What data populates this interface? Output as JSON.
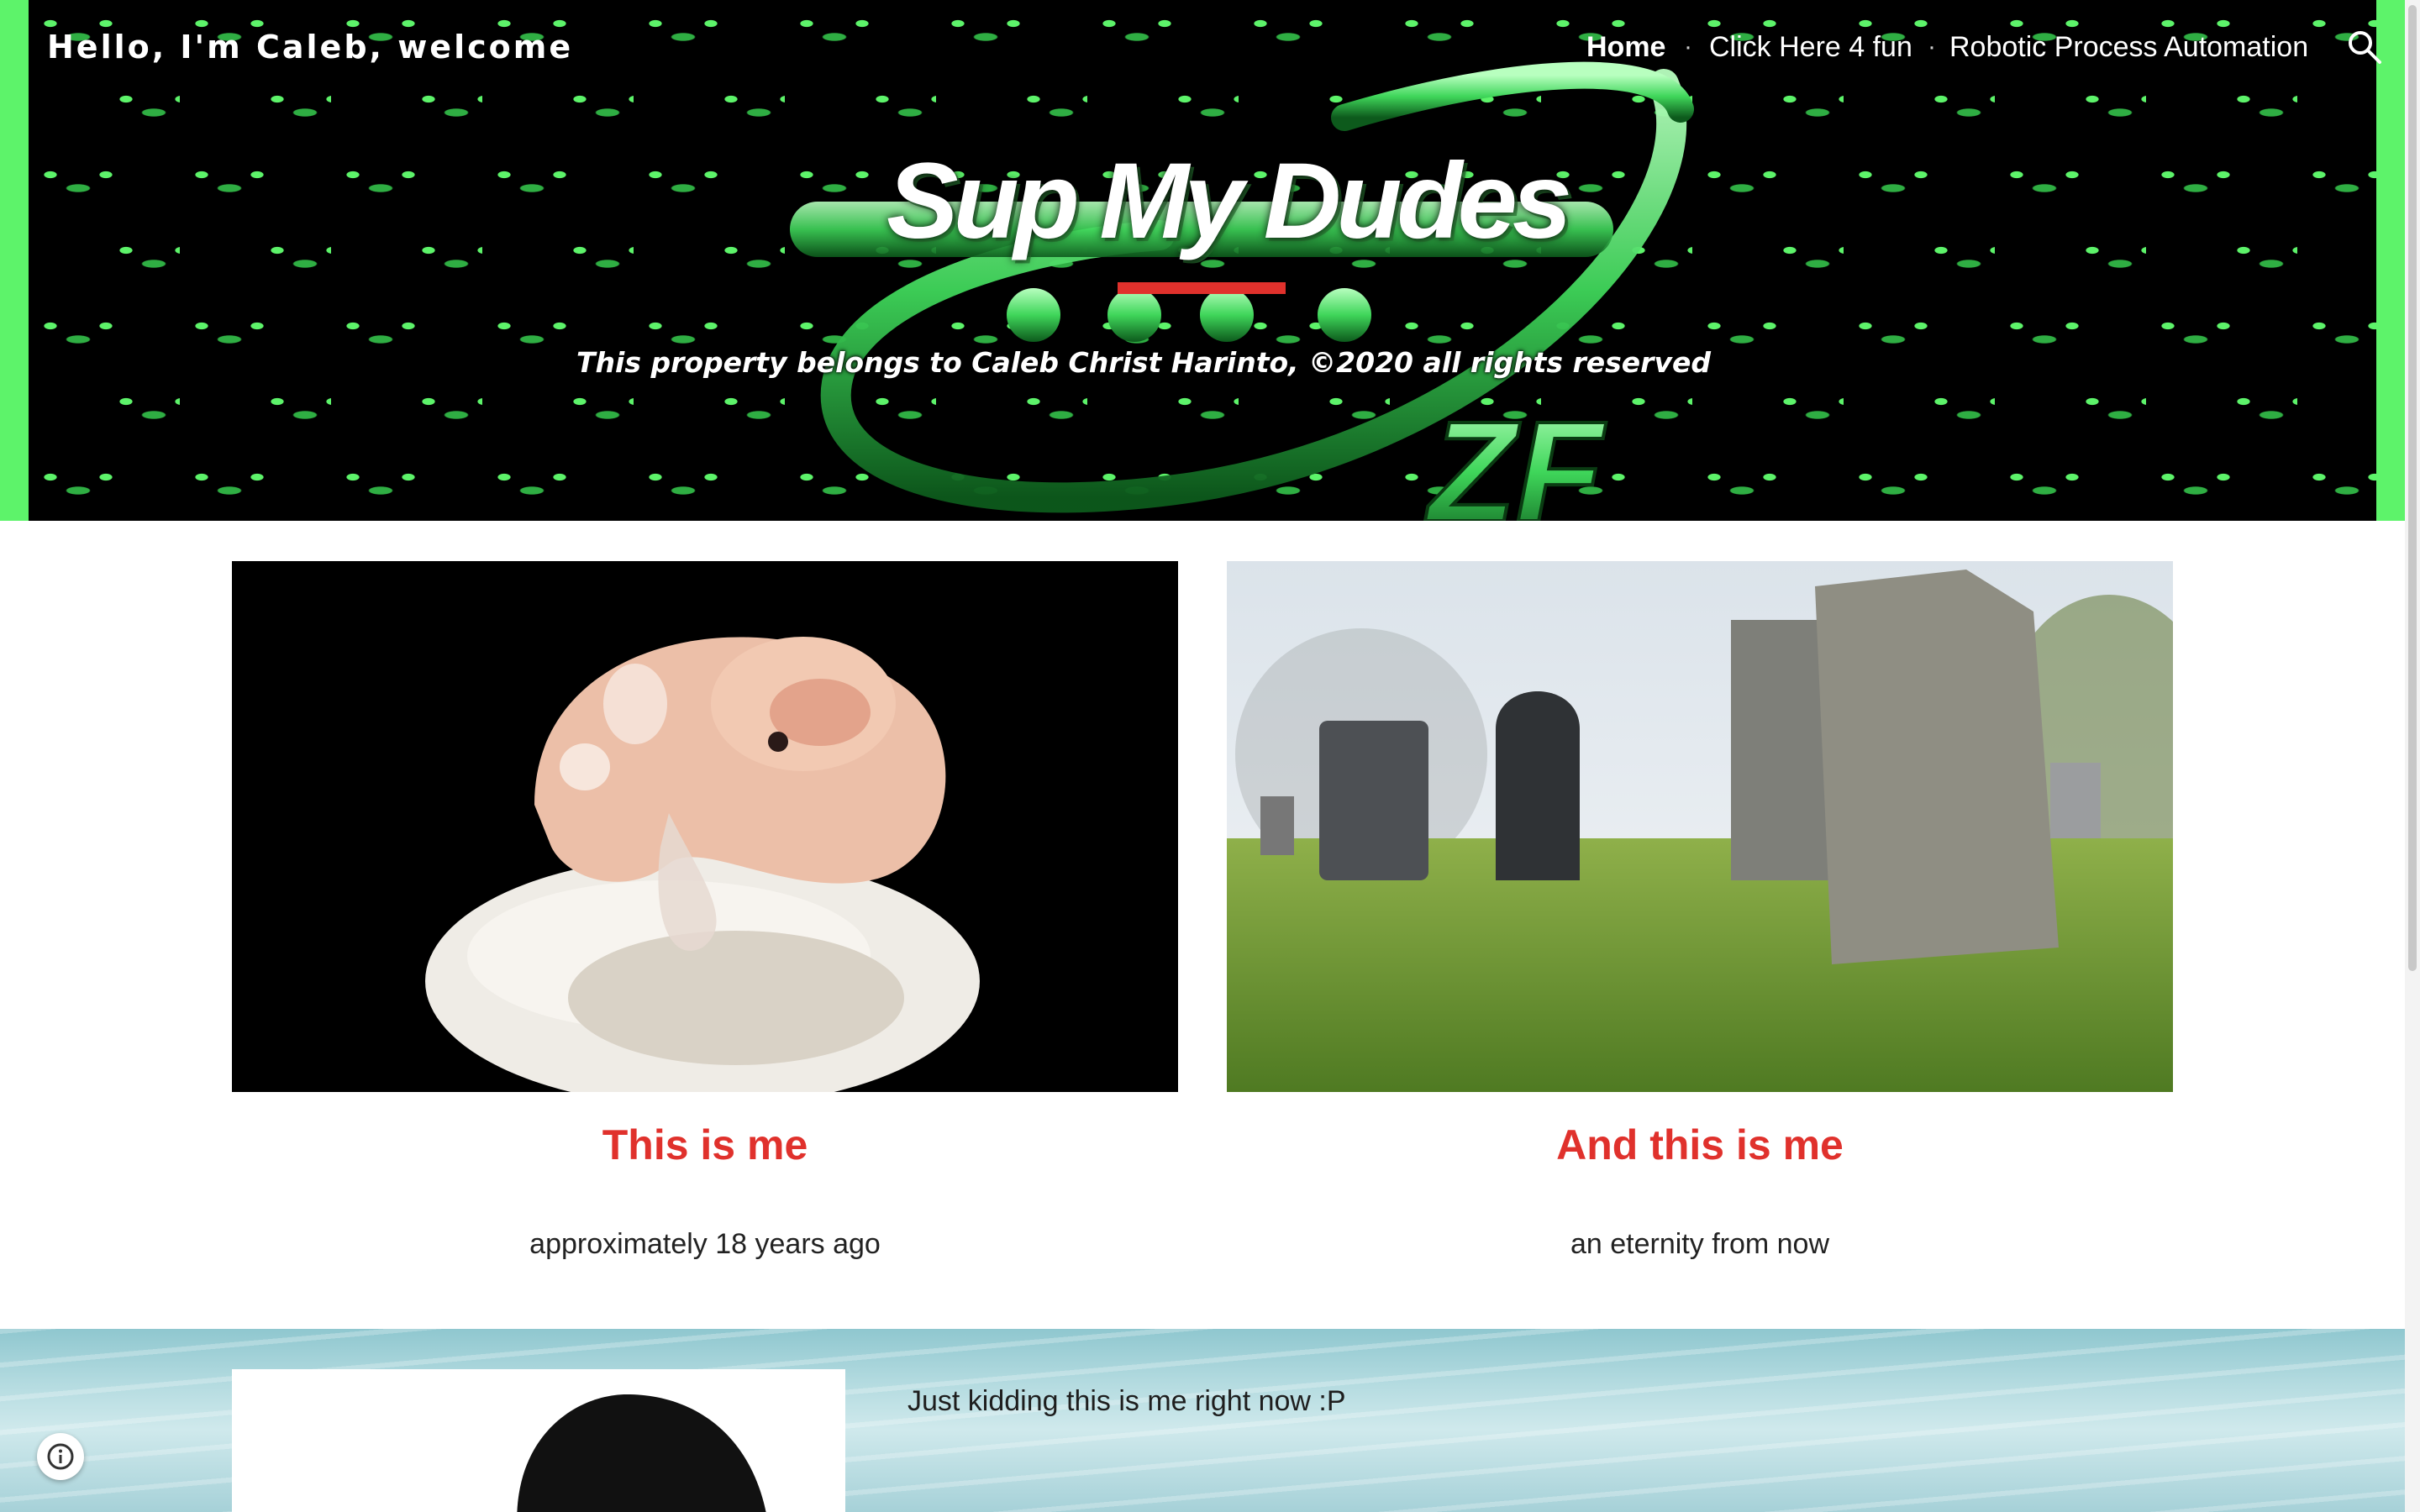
{
  "header": {
    "site_title": "Hello, I'm Caleb, welcome",
    "nav": [
      {
        "label": "Home",
        "active": true
      },
      {
        "label": "Click Here 4 fun",
        "active": false
      },
      {
        "label": "Robotic Process Automation",
        "active": false
      }
    ],
    "search_icon": "search-icon",
    "banner_logo_text": "ZF",
    "colors": {
      "accent": "#5df36a",
      "banner_bg": "#000000"
    }
  },
  "hero": {
    "title": "Sup My Dudes",
    "subtitle": "This property belongs to Caleb Christ Harinto, ©2020 all rights reserved",
    "rule_color": "#e0312c"
  },
  "cards": [
    {
      "heading": "This is me",
      "caption": "approximately 18 years ago",
      "image": "embryo-photo"
    },
    {
      "heading": "And this is me",
      "caption": "an eternity from now",
      "image": "graveyard-photo"
    }
  ],
  "lower": {
    "text": "Just kidding this is me right now :P",
    "image": "portrait-photo"
  },
  "colors": {
    "heading_red": "#e0312c"
  }
}
